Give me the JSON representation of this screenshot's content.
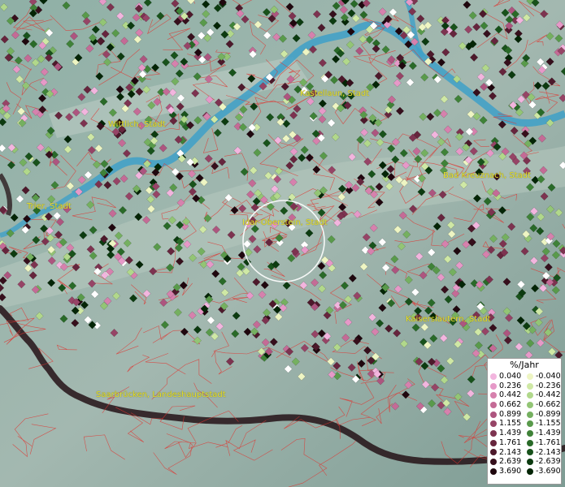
{
  "legend": {
    "title": "%/Jahr",
    "positive": [
      {
        "label": "0.040",
        "color": "#f2b5de"
      },
      {
        "label": "0.236",
        "color": "#e699c8"
      },
      {
        "label": "0.442",
        "color": "#d681ad"
      },
      {
        "label": "0.662",
        "color": "#c46b96"
      },
      {
        "label": "0.899",
        "color": "#ad557f"
      },
      {
        "label": "1.155",
        "color": "#964466"
      },
      {
        "label": "1.439",
        "color": "#7d3350"
      },
      {
        "label": "1.761",
        "color": "#66253d"
      },
      {
        "label": "2.143",
        "color": "#4d192b"
      },
      {
        "label": "2.639",
        "color": "#360f1c"
      },
      {
        "label": "3.690",
        "color": "#1f070e"
      }
    ],
    "negative": [
      {
        "label": "-0.040",
        "color": "#eef5c3"
      },
      {
        "label": "-0.236",
        "color": "#cfe8a5"
      },
      {
        "label": "-0.442",
        "color": "#b1d88b"
      },
      {
        "label": "-0.662",
        "color": "#93c575"
      },
      {
        "label": "-0.899",
        "color": "#75b060"
      },
      {
        "label": "-1.155",
        "color": "#599a4b"
      },
      {
        "label": "-1.439",
        "color": "#3f8238"
      },
      {
        "label": "-1.761",
        "color": "#296a28"
      },
      {
        "label": "-2.143",
        "color": "#18521b"
      },
      {
        "label": "-2.639",
        "color": "#0c3b10"
      },
      {
        "label": "-3.690",
        "color": "#042506"
      }
    ]
  },
  "places": [
    {
      "name": "Kastellaun, Stadt"
    },
    {
      "name": "Wittlich, Stadt"
    },
    {
      "name": "Bad Kreuznach, Stadt"
    },
    {
      "name": "Trier, Stadt"
    },
    {
      "name": "Idar-Oberstein, Stadt"
    },
    {
      "name": "Kaiserslautern, Stadt"
    },
    {
      "name": "Saarbrücken, Landeshauptstadt"
    }
  ]
}
